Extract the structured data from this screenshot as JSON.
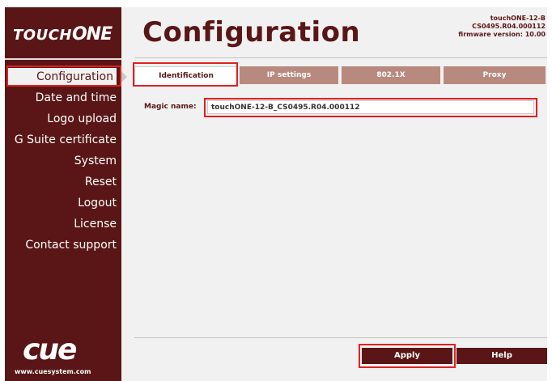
{
  "sidebar": {
    "logo_part1": "TOUCH",
    "logo_part2": "ONE",
    "items": [
      {
        "label": "Configuration"
      },
      {
        "label": "Date and time"
      },
      {
        "label": "Logo upload"
      },
      {
        "label": "G Suite certificate"
      },
      {
        "label": "System"
      },
      {
        "label": "Reset"
      },
      {
        "label": "Logout"
      },
      {
        "label": "License"
      },
      {
        "label": "Contact support"
      }
    ],
    "brand": "cue",
    "url": "www.cuesystem.com"
  },
  "header": {
    "title": "Configuration",
    "device_name": "touchONE-12-B",
    "serial": "CS0495.R04.000112",
    "firmware": "firmware version: 10.00"
  },
  "tabs": [
    {
      "label": "Identification",
      "active": true
    },
    {
      "label": "IP settings",
      "active": false
    },
    {
      "label": "802.1X",
      "active": false
    },
    {
      "label": "Proxy",
      "active": false
    }
  ],
  "form": {
    "magic_name_label": "Magic name:",
    "magic_name_value": "touchONE-12-B_CS0495.R04.000112"
  },
  "buttons": {
    "apply": "Apply",
    "help": "Help"
  },
  "colors": {
    "brand": "#5a1616",
    "tab_inactive": "#b8897f",
    "highlight": "#e02020"
  }
}
